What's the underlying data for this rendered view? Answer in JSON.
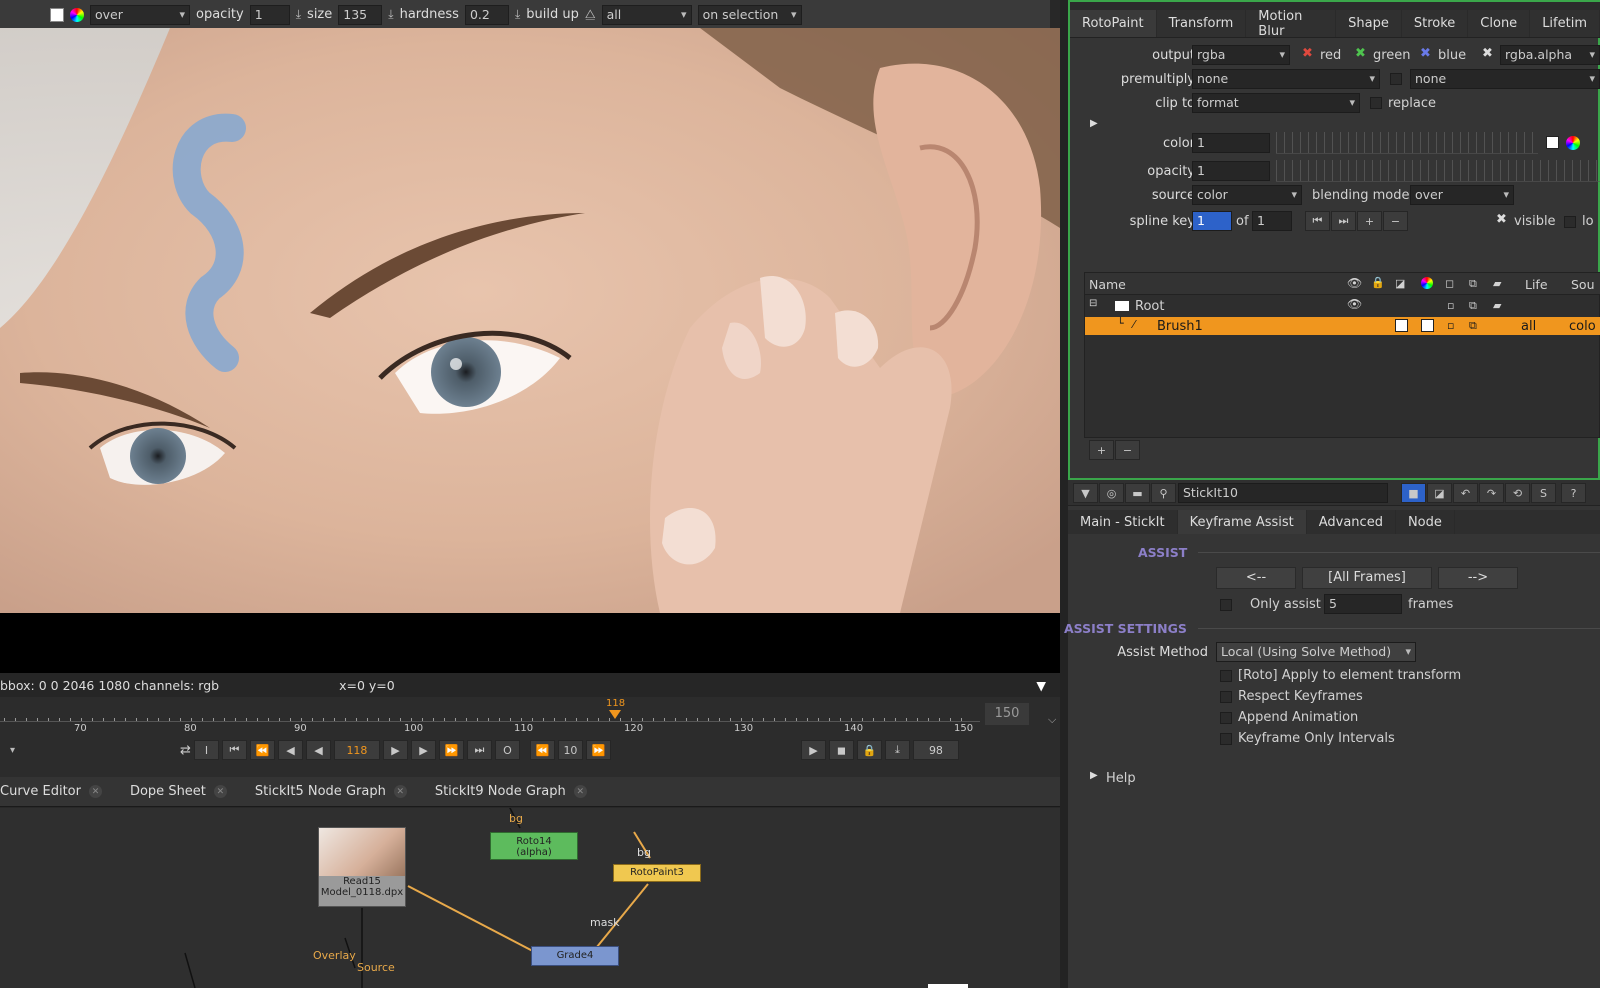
{
  "toolbar": {
    "blend": "over",
    "opacity_label": "opacity",
    "opacity_value": "1",
    "size_label": "size",
    "size_value": "135",
    "hardness_label": "hardness",
    "hardness_value": "0.2",
    "buildup_label": "build up",
    "lifetime": "all",
    "selection": "on selection"
  },
  "viewer": {
    "bbox_text": "bbox: 0 0 2046 1080 channels: rgb",
    "coords": "x=0 y=0"
  },
  "timeline": {
    "ticks": [
      "70",
      "80",
      "90",
      "100",
      "110",
      "120",
      "130",
      "140",
      "150"
    ],
    "marker": "118",
    "current_frame": "118",
    "end_frame": "150",
    "step": "10",
    "fps": "98",
    "o_label": "O"
  },
  "bottom_tabs": [
    "Curve Editor",
    "Dope Sheet",
    "StickIt5 Node Graph",
    "StickIt9 Node Graph"
  ],
  "nodes": {
    "read": "Read15",
    "read_file": "Model_0118.dpx",
    "roto": "Roto14",
    "roto_sub": "(alpha)",
    "rotopaint": "RotoPaint3",
    "grade": "Grade4",
    "bg1": "bg",
    "bg2": "bg",
    "mask": "mask",
    "overlay": "Overlay",
    "source": "Source"
  },
  "rotopaint": {
    "tabs": [
      "RotoPaint",
      "Transform",
      "Motion Blur",
      "Shape",
      "Stroke",
      "Clone",
      "Lifetim"
    ],
    "output_label": "output",
    "output_value": "rgba",
    "red": "red",
    "green": "green",
    "blue": "blue",
    "alpha": "rgba.alpha",
    "premultiply_label": "premultiply",
    "premultiply_value": "none",
    "premultiply_value2": "none",
    "clip_label": "clip to",
    "clip_value": "format",
    "replace": "replace",
    "color_label": "color",
    "color_value": "1",
    "opacity_label": "opacity",
    "opacity_value": "1",
    "source_label": "source",
    "source_value": "color",
    "blending_label": "blending mode",
    "blending_value": "over",
    "splinekey_label": "spline key",
    "splinekey_value": "1",
    "of_label": "of",
    "of_value": "1",
    "visible": "visible",
    "lo": "lo",
    "col_name": "Name",
    "col_life": "Life",
    "col_sou": "Sou",
    "root": "Root",
    "brush": "Brush1",
    "brush_life": "all",
    "brush_col": "colo"
  },
  "stickit": {
    "name": "StickIt10",
    "tabs": [
      "Main - StickIt",
      "Keyframe Assist",
      "Advanced",
      "Node"
    ],
    "assist_title": "ASSIST",
    "prev": "<--",
    "all": "[All Frames]",
    "next": "-->",
    "only_assist": "Only assist",
    "only_value": "5",
    "frames": "frames",
    "settings_title": "ASSIST SETTINGS",
    "method_label": "Assist Method",
    "method_value": "Local (Using Solve Method)",
    "opt1": "[Roto] Apply to element transform",
    "opt2": "Respect Keyframes",
    "opt3": "Append Animation",
    "opt4": "Keyframe Only Intervals",
    "help": "Help"
  },
  "colors": {
    "accent_green": "#3aa64a",
    "selection_orange": "#f0961e",
    "section_purple": "#8c7fc8"
  }
}
